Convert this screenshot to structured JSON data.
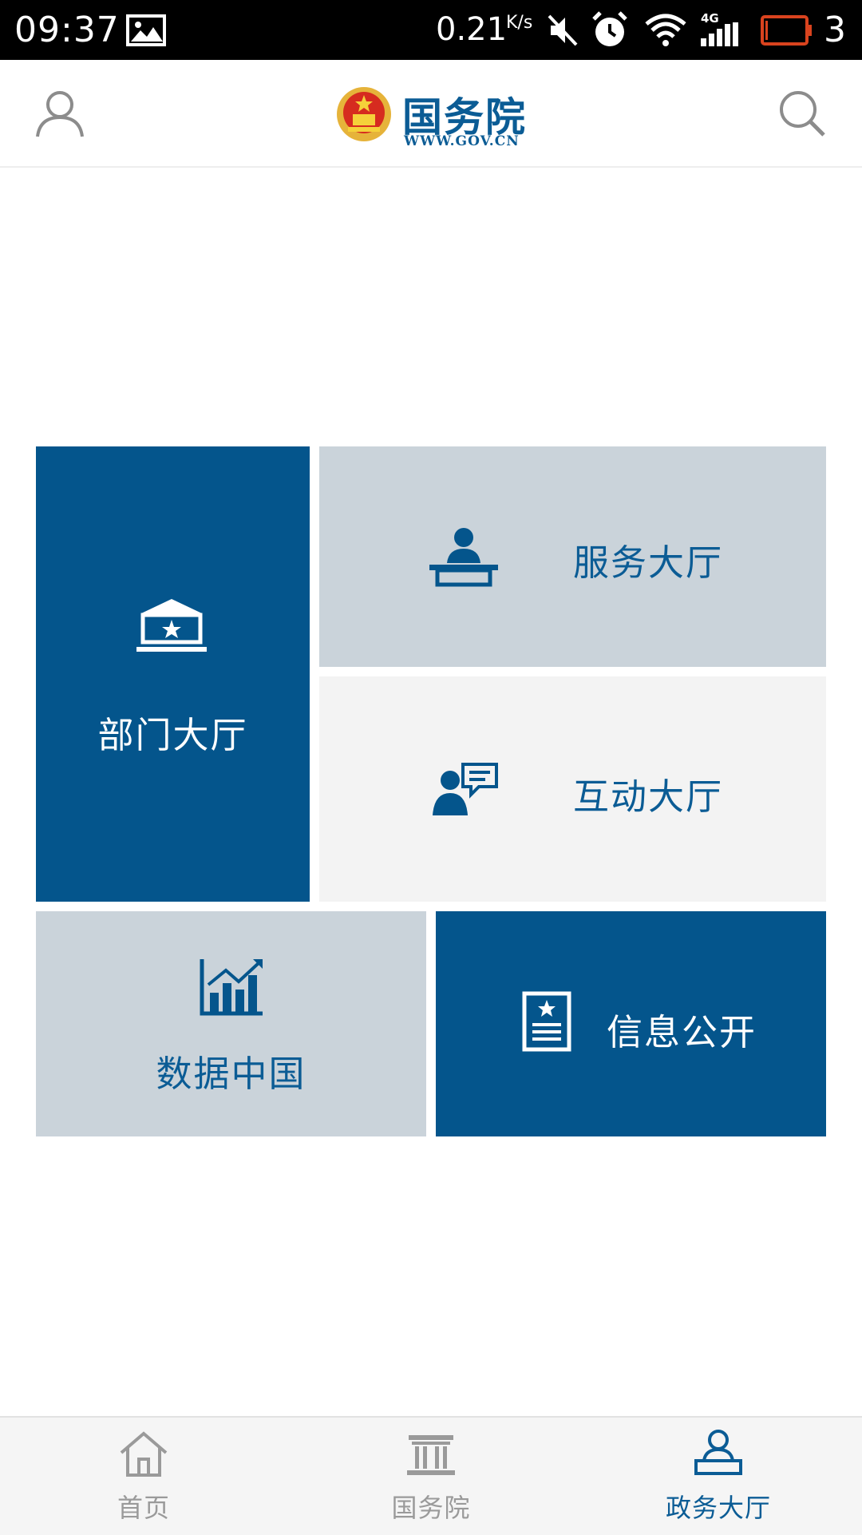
{
  "status_bar": {
    "time": "09:37",
    "net_speed": "0.21",
    "net_speed_unit": "K/s",
    "network_type": "4G",
    "battery_level": "3",
    "icons": [
      "image-icon",
      "mute-icon",
      "alarm-icon",
      "wifi-icon",
      "signal-icon",
      "battery-icon"
    ]
  },
  "header": {
    "brand_cn": "国务院",
    "brand_url": "WWW.GOV.CN",
    "icons": [
      "user-icon",
      "emblem-logo",
      "search-icon"
    ]
  },
  "tiles": {
    "dept": "部门大厅",
    "service": "服务大厅",
    "interact": "互动大厅",
    "data": "数据中国",
    "info": "信息公开"
  },
  "bottom_nav": {
    "items": [
      {
        "label": "首页",
        "icon": "home-icon"
      },
      {
        "label": "国务院",
        "icon": "building-icon"
      },
      {
        "label": "政务大厅",
        "icon": "hall-icon"
      }
    ],
    "active_index": 2
  },
  "colors": {
    "brand_blue": "#04558c",
    "tile_gray": "#cad3da",
    "tile_light": "#f3f3f3",
    "nav_inactive": "#9a9a9a",
    "nav_active": "#0b5c95"
  }
}
